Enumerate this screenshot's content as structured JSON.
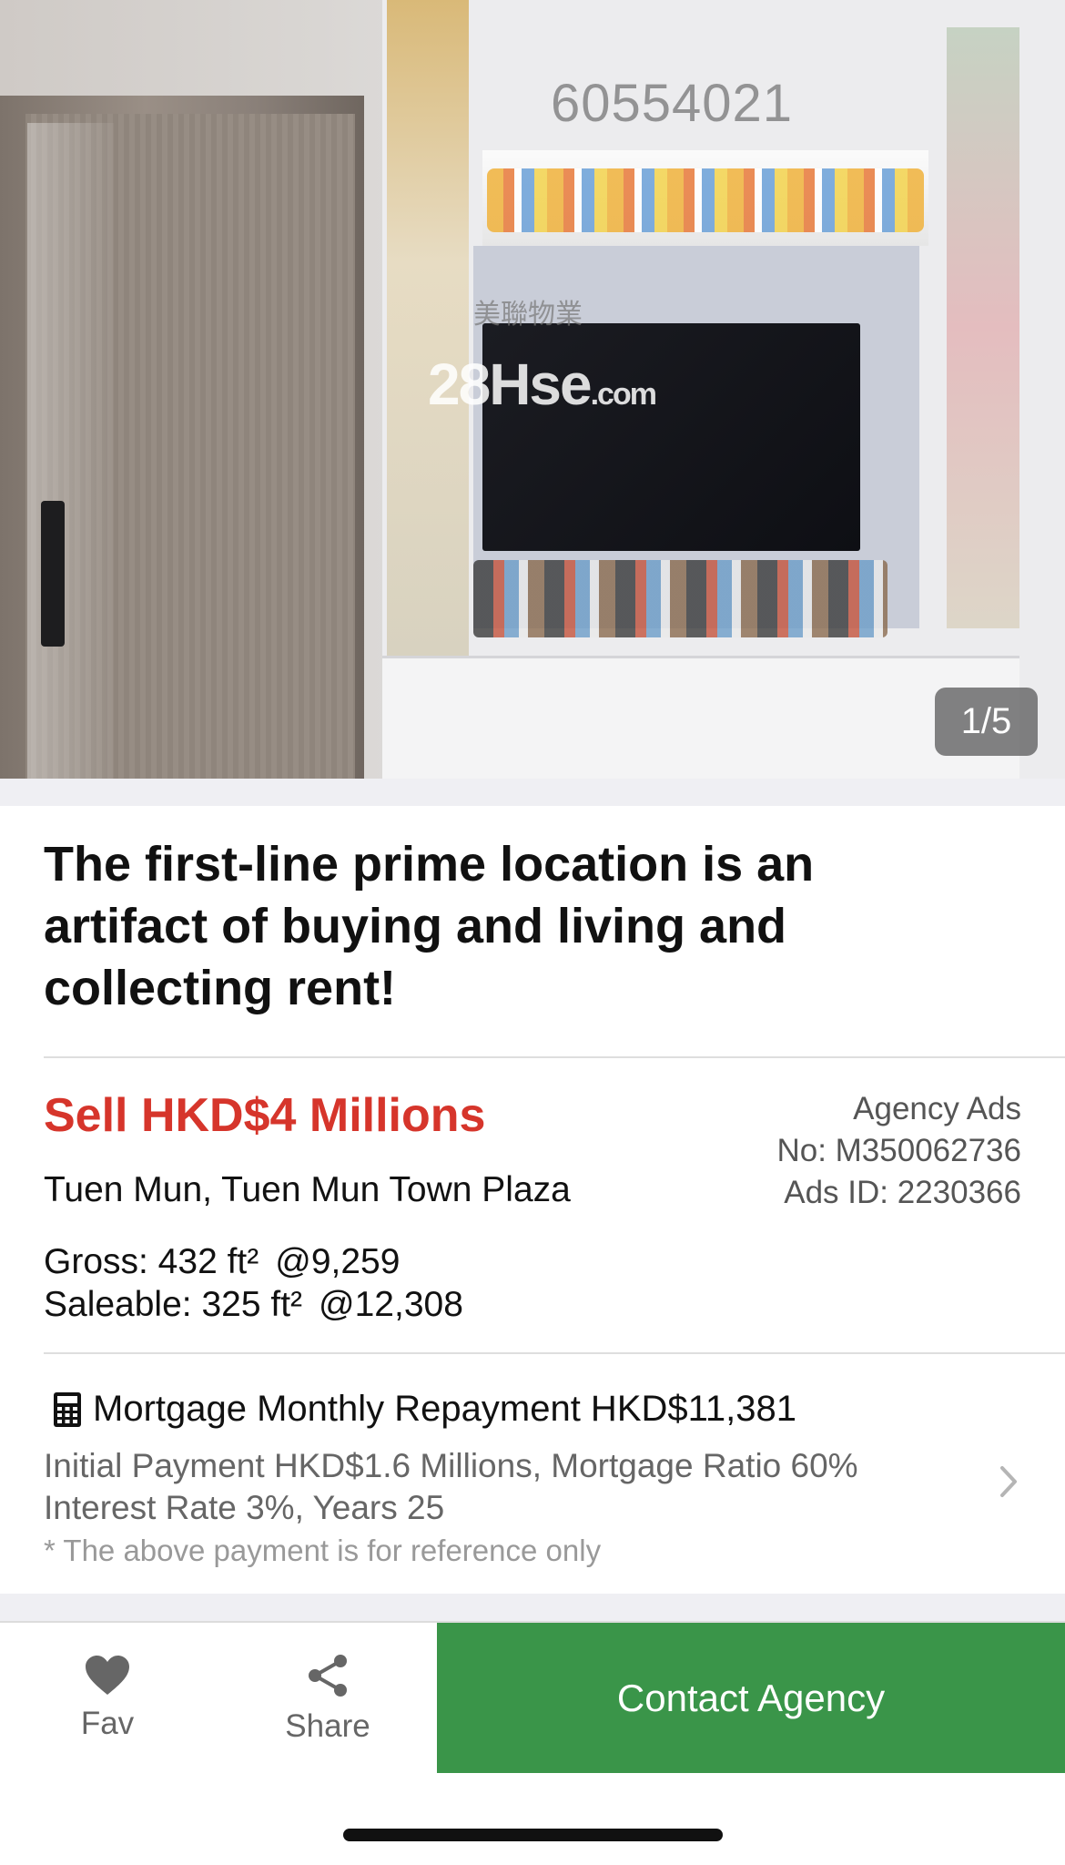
{
  "photo": {
    "watermark_number": "60554021",
    "watermark_agency": "美聯物業",
    "watermark_site": "28Hse",
    "watermark_site_tld": ".com",
    "counter": "1/5"
  },
  "listing": {
    "title": "The first-line prime location is an artifact of buying and living and collecting rent!",
    "price": "Sell HKD$4 Millions",
    "location": "Tuen Mun, Tuen Mun Town Plaza",
    "gross_label": "Gross: 432 ft²",
    "gross_rate": "@9,259",
    "saleable_label": "Saleable: 325 ft²",
    "saleable_rate": "@12,308",
    "agency_type": "Agency Ads",
    "agency_no": "No: M350062736",
    "ads_id": "Ads ID: 2230366"
  },
  "mortgage": {
    "title": "Mortgage Monthly Repayment HKD$11,381",
    "line1": "Initial Payment HKD$1.6 Millions, Mortgage Ratio 60%",
    "line2": "Interest Rate 3%, Years 25",
    "note": "* The above payment is for reference only"
  },
  "bottom_bar": {
    "fav_label": "Fav",
    "share_label": "Share",
    "contact_label": "Contact Agency"
  },
  "colors": {
    "price_red": "#d6352b",
    "contact_green": "#3a9549"
  },
  "icons": [
    "calculator-icon",
    "chevron-right-icon",
    "heart-icon",
    "share-icon"
  ]
}
